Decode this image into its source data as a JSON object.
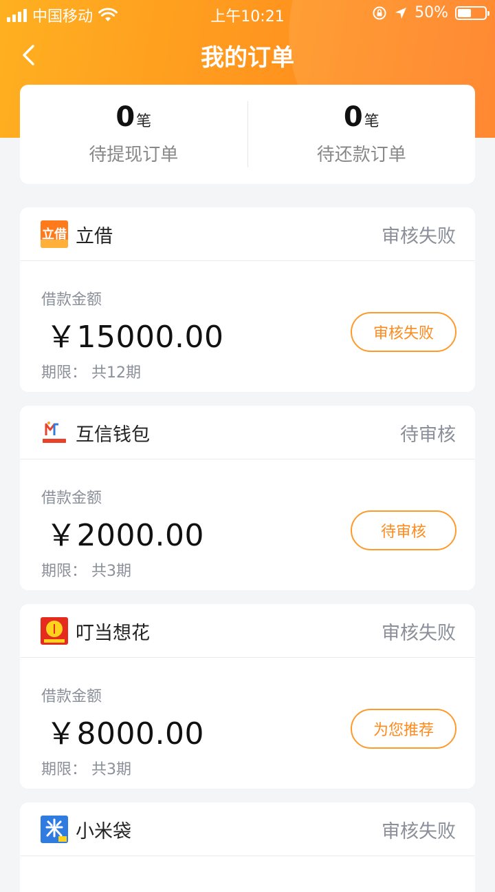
{
  "status_bar": {
    "carrier": "中国移动",
    "time": "上午10:21",
    "battery": "50%"
  },
  "nav": {
    "title": "我的订单"
  },
  "summary": {
    "withdraw": {
      "count": "0",
      "unit": "笔",
      "label": "待提现订单"
    },
    "repay": {
      "count": "0",
      "unit": "笔",
      "label": "待还款订单"
    }
  },
  "orders": [
    {
      "lender": "立借",
      "status": "审核失败",
      "amount_label": "借款金额",
      "amount": "￥15000.00",
      "term": "期限：  共12期",
      "button": "审核失败"
    },
    {
      "lender": "互信钱包",
      "status": "待审核",
      "amount_label": "借款金额",
      "amount": "￥2000.00",
      "term": "期限：  共3期",
      "button": "待审核"
    },
    {
      "lender": "叮当想花",
      "status": "审核失败",
      "amount_label": "借款金额",
      "amount": "￥8000.00",
      "term": "期限：  共3期",
      "button": "为您推荐"
    },
    {
      "lender": "小米袋",
      "status": "审核失败"
    }
  ],
  "colors": {
    "accent": "#ff8a1c",
    "header_start": "#ffb020",
    "header_end": "#ff7b1c",
    "muted_text": "#8a8f99"
  },
  "icons": {
    "back": "chevron-left-icon",
    "wifi": "wifi-icon",
    "location": "location-arrow-icon",
    "lock_rotation": "rotation-lock-icon",
    "battery": "battery-icon"
  }
}
